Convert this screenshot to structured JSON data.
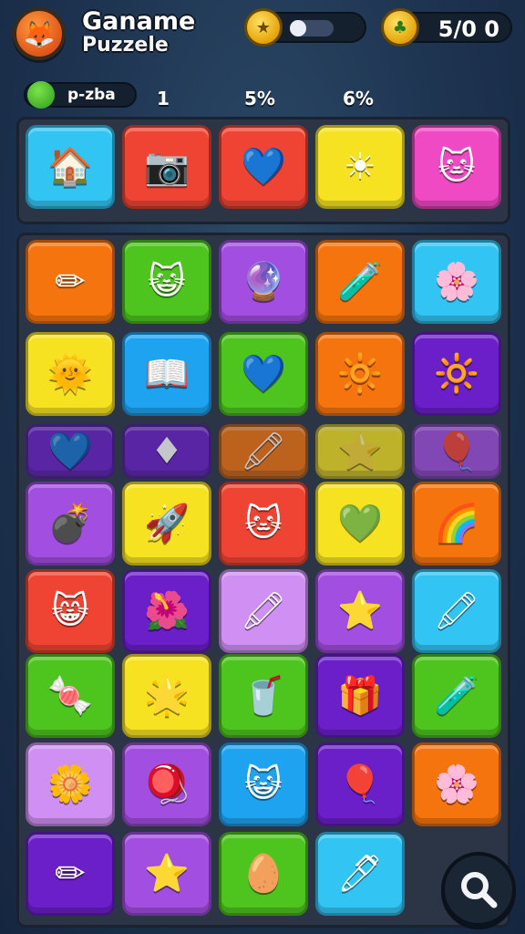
{
  "header": {
    "title_line1": "Ganame",
    "title_line2": "Puzzele",
    "coin_pill_icon": "gold-star-coin-icon",
    "score_pill_icon": "gold-clover-coin-icon",
    "score_value": "5/0 0",
    "sub_label": "p-zba",
    "stats": [
      "1",
      "5%",
      "6%"
    ]
  },
  "colors": {
    "red": "#ef4433",
    "orange": "#f5740e",
    "yellow": "#f7e221",
    "green": "#4ec51f",
    "blue": "#1ea3f0",
    "cyan": "#32c4f2",
    "purple": "#a24ee0",
    "violet": "#6b1fc9",
    "pink": "#ef49c4",
    "lilac": "#d08ff2"
  },
  "top_row": [
    {
      "name": "house-icon",
      "bg": "cyan",
      "glyph": "🏠"
    },
    {
      "name": "camera-icon",
      "bg": "red",
      "glyph": "📷"
    },
    {
      "name": "blue-bird-icon",
      "bg": "red",
      "glyph": "💙"
    },
    {
      "name": "sun-icon",
      "bg": "yellow",
      "glyph": "☀"
    },
    {
      "name": "cat-face-icon",
      "bg": "pink",
      "glyph": "🐱"
    }
  ],
  "grid": [
    [
      {
        "name": "blue-crayon-icon",
        "bg": "orange",
        "glyph": "✏"
      },
      {
        "name": "cat-face-icon",
        "bg": "green",
        "glyph": "😺"
      },
      {
        "name": "purple-ball-icon",
        "bg": "purple",
        "glyph": "🔮"
      },
      {
        "name": "green-bottle-icon",
        "bg": "orange",
        "glyph": "🧪"
      },
      {
        "name": "pink-star-face-icon",
        "bg": "cyan",
        "glyph": "🌸"
      }
    ],
    [
      {
        "name": "green-sun-face-icon",
        "bg": "yellow",
        "glyph": "🌞"
      },
      {
        "name": "book-icon",
        "bg": "blue",
        "glyph": "📖"
      },
      {
        "name": "blue-heart-icon",
        "bg": "green",
        "glyph": "💙"
      },
      {
        "name": "orange-sun-icon",
        "bg": "orange",
        "glyph": "🔆"
      },
      {
        "name": "orange-sun-icon",
        "bg": "violet",
        "glyph": "🔆"
      }
    ],
    [
      {
        "name": "blue-heart-icon",
        "bg": "violet",
        "glyph": "💙",
        "faded": true
      },
      {
        "name": "red-crystal-icon",
        "bg": "violet",
        "glyph": "♦",
        "faded": true
      },
      {
        "name": "green-crayon-icon",
        "bg": "orange",
        "glyph": "🖍",
        "faded": true
      },
      {
        "name": "orange-star-icon",
        "bg": "yellow",
        "glyph": "⭐",
        "faded": true
      },
      {
        "name": "purple-balloon-icon",
        "bg": "purple",
        "glyph": "🎈",
        "faded": true
      }
    ],
    [
      {
        "name": "blue-bomb-icon",
        "bg": "purple",
        "glyph": "💣"
      },
      {
        "name": "blue-rocket-icon",
        "bg": "yellow",
        "glyph": "🚀"
      },
      {
        "name": "cat-face-icon",
        "bg": "red",
        "glyph": "🐱"
      },
      {
        "name": "green-heart-icon",
        "bg": "yellow",
        "glyph": "💚"
      },
      {
        "name": "rainbow-ball-icon",
        "bg": "orange",
        "glyph": "🌈"
      }
    ],
    [
      {
        "name": "green-cat-face-icon",
        "bg": "red",
        "glyph": "😸"
      },
      {
        "name": "pink-flower-icon",
        "bg": "violet",
        "glyph": "🌺"
      },
      {
        "name": "green-crayon-icon",
        "bg": "lilac",
        "glyph": "🖍"
      },
      {
        "name": "yellow-star-icon",
        "bg": "purple",
        "glyph": "⭐"
      },
      {
        "name": "pink-crayon-icon",
        "bg": "cyan",
        "glyph": "🖍"
      }
    ],
    [
      {
        "name": "blue-candy-icon",
        "bg": "green",
        "glyph": "🍬"
      },
      {
        "name": "orange-star-icon",
        "bg": "yellow",
        "glyph": "🌟"
      },
      {
        "name": "blue-cup-icon",
        "bg": "green",
        "glyph": "🥤"
      },
      {
        "name": "gift-box-icon",
        "bg": "violet",
        "glyph": "🎁"
      },
      {
        "name": "green-bottle-icon",
        "bg": "green",
        "glyph": "🧪"
      }
    ],
    [
      {
        "name": "purple-flower-icon",
        "bg": "lilac",
        "glyph": "🌼"
      },
      {
        "name": "rainbow-ball-icon",
        "bg": "purple",
        "glyph": "🪀"
      },
      {
        "name": "yellow-cat-face-icon",
        "bg": "blue",
        "glyph": "😺"
      },
      {
        "name": "rainbow-balloon-icon",
        "bg": "violet",
        "glyph": "🎈"
      },
      {
        "name": "pink-sun-icon",
        "bg": "orange",
        "glyph": "🌸"
      }
    ],
    [
      {
        "name": "pink-crayon-icon",
        "bg": "violet",
        "glyph": "✏"
      },
      {
        "name": "yellow-star-icon",
        "bg": "purple",
        "glyph": "⭐"
      },
      {
        "name": "green-egg-icon",
        "bg": "green",
        "glyph": "🥚"
      },
      {
        "name": "blue-crayon-icon",
        "bg": "cyan",
        "glyph": "🖊"
      }
    ]
  ],
  "search_button": {
    "icon": "magnifier-icon"
  }
}
